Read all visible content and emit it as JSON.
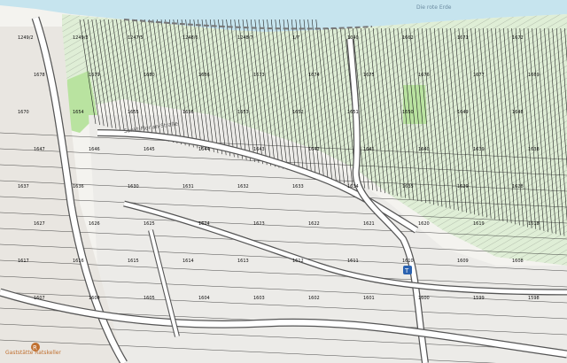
{
  "map": {
    "type": "cadastral parcel map",
    "river_label": "Die rote Erde",
    "street_label": "Sankt-Florian-Straße",
    "poi_label": "Gaststätte Ratskeller",
    "parcel_numbers": [
      "1249/2",
      "1249/3",
      "1247/5",
      "1248/6",
      "1248/7",
      "1/7",
      "1040",
      "1662",
      "1671",
      "1672",
      "1678",
      "1679",
      "1680",
      "1686",
      "1673",
      "1674",
      "1675",
      "1676",
      "1677",
      "1669",
      "1670",
      "1654",
      "1655",
      "1656",
      "1653",
      "1652",
      "1651",
      "1650",
      "1649",
      "1648",
      "1647",
      "1646",
      "1645",
      "1644",
      "1643",
      "1642",
      "1641",
      "1640",
      "1639",
      "1638",
      "1637",
      "1636",
      "1630",
      "1631",
      "1632",
      "1633",
      "1634",
      "1635",
      "1629",
      "1628",
      "1627",
      "1626",
      "1625",
      "1624",
      "1623",
      "1622",
      "1621",
      "1620",
      "1619",
      "1618",
      "1617",
      "1616",
      "1615",
      "1614",
      "1613",
      "1612",
      "1611",
      "1610",
      "1609",
      "1608",
      "1607",
      "1606",
      "1605",
      "1604",
      "1603",
      "1602",
      "1601",
      "1600",
      "1599",
      "1598"
    ],
    "colors": {
      "water": "#c6e4ee",
      "vineyard": "#dfeed6",
      "green_area": "#b9e3a0",
      "built_area": "#e9e6e1",
      "road": "#ffffff",
      "road_casing": "#555555",
      "parcel_line": "#222222",
      "label": "#111111",
      "poi": "#c07030"
    },
    "icons": {
      "poi": "restaurant-icon",
      "tram": "tram-stop-icon"
    }
  }
}
